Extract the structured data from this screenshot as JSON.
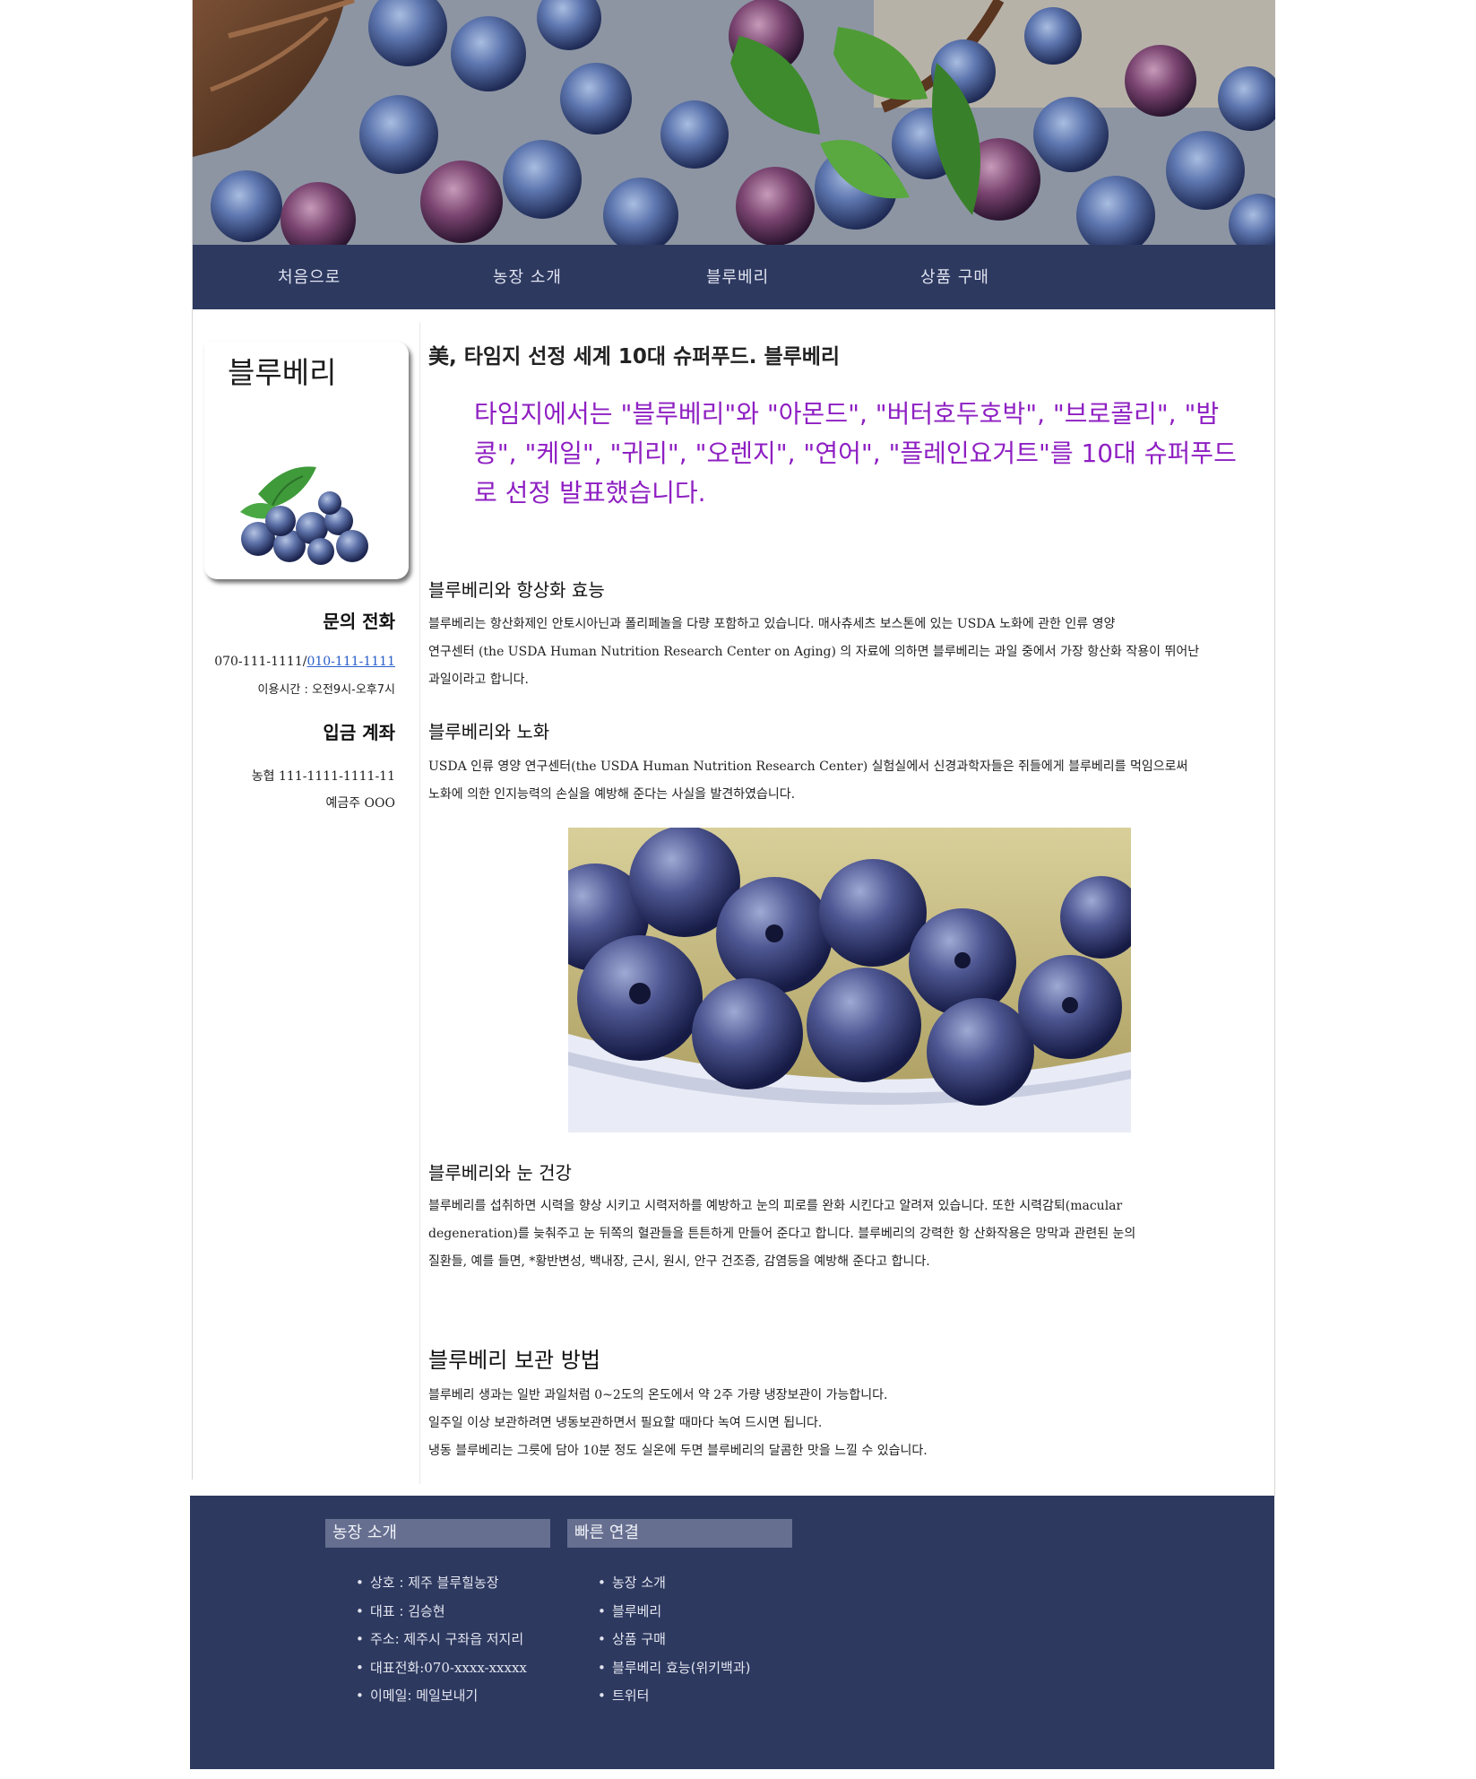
{
  "nav": {
    "items": [
      "처음으로",
      "농장 소개",
      "블루베리",
      "상품 구매"
    ]
  },
  "sidebar": {
    "card_title": "블루베리",
    "contact_heading": "문의 전화",
    "phone_plain": "070-111-1111/",
    "phone_link": "010-111-1111",
    "hours": "이용시간 : 오전9시-오후7시",
    "deposit_heading": "입금 계좌",
    "account": "농협 111-1111-1111-11",
    "account_holder": "예금주 OOO"
  },
  "main": {
    "headline": "美, 타임지 선정 세계 10대 슈퍼푸드. 블루베리",
    "quote": "타임지에서는 \"블루베리\"와 \"아몬드\", \"버터호두호박\", \"브로콜리\", \"밤콩\", \"케일\", \"귀리\", \"오렌지\", \"연어\", \"플레인요거트\"를 10대 슈퍼푸드로 선정 발표했습니다.",
    "sections": [
      {
        "title": "블루베리와 항상화 효능",
        "lines": [
          "블루베리는 항산화제인 안토시아닌과 폴리페놀을 다량 포함하고 있습니다. 매사츄세츠 보스톤에 있는 USDA 노화에 관한 인류 영양",
          "연구센터 (the USDA Human Nutrition Research Center on Aging) 의 자료에 의하면 블루베리는 과일 중에서 가장 항산화 작용이 뛰어난",
          "과일이라고 합니다."
        ]
      },
      {
        "title": "블루베리와 노화",
        "lines": [
          "USDA 인류 영양 연구센터(the USDA Human Nutrition Research Center) 실험실에서 신경과학자들은 쥐들에게 블루베리를 먹임으로써",
          "노화에 의한 인지능력의 손실을 예방해 준다는 사실을 발견하였습니다."
        ]
      },
      {
        "title": "블루베리와 눈 건강",
        "lines": [
          "블루베리를 섭취하면 시력을 향상 시키고 시력저하를 예방하고 눈의 피로를 완화 시킨다고 알려져 있습니다. 또한 시력감퇴(macular",
          "degeneration)를 늦춰주고 눈 뒤쪽의 혈관들을 튼튼하게 만들어 준다고 합니다. 블루베리의 강력한 항 산화작용은 망막과 관련된 눈의",
          "질환들, 예를 들면, *황반변성, 백내장, 근시, 원시, 안구 건조증, 감염등을 예방해 준다고 합니다."
        ]
      },
      {
        "title": "블루베리 보관 방법",
        "lines": [
          "블루베리 생과는 일반 과일처럼 0~2도의 온도에서 약 2주 가량 냉장보관이 가능합니다.",
          "일주일 이상 보관하려면 냉동보관하면서 필요할 때마다 녹여 드시면 됩니다.",
          "냉동 블루베리는 그릇에 담아 10분 정도 실온에 두면 블루베리의 달콤한 맛을 느낄 수 있습니다."
        ]
      }
    ]
  },
  "footer": {
    "farm_heading": "농장 소개",
    "farm_items": [
      "상호 : 제주 블루힐농장",
      "대표 : 김승현",
      "주소: 제주시 구좌읍 저지리",
      "대표전화:070-xxxx-xxxxx",
      "이메일: 메일보내기"
    ],
    "links_heading": "빠른 연결",
    "link_items": [
      "농장 소개",
      "블루베리",
      "상품 구매",
      "블루베리 효능(위키백과)",
      "트위터"
    ]
  },
  "colors": {
    "navy": "#2e3960",
    "footer_heading_bg": "#666f90",
    "quote_purple": "#8e1fc2",
    "link_blue": "#2a5fc9"
  },
  "icons": {
    "hero": "blueberry-basket-photo",
    "sidebar": "blueberry-mint-photo",
    "content": "blueberry-bowl-photo"
  }
}
